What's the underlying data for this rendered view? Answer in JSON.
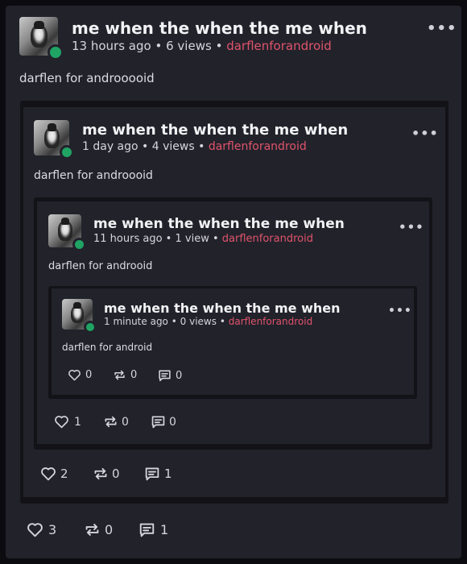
{
  "posts": [
    {
      "title": "me when the when the me when",
      "time": "13 hours ago",
      "views": "6 views",
      "username": "darflenforandroid",
      "body": "darflen for androoooid",
      "likes": "3",
      "reposts": "0",
      "comments": "1"
    },
    {
      "title": "me when the when the me when",
      "time": "1 day ago",
      "views": "4 views",
      "username": "darflenforandroid",
      "body": "darflen for androooid",
      "likes": "2",
      "reposts": "0",
      "comments": "1"
    },
    {
      "title": "me when the when the me when",
      "time": "11 hours ago",
      "views": "1 view",
      "username": "darflenforandroid",
      "body": "darflen for androoid",
      "likes": "1",
      "reposts": "0",
      "comments": "0"
    },
    {
      "title": "me when the when the me when",
      "time": "1 minute ago",
      "views": "0 views",
      "username": "darflenforandroid",
      "body": "darflen for android",
      "likes": "0",
      "reposts": "0",
      "comments": "0"
    }
  ],
  "separator": "•",
  "more_icon": "more-horizontal-icon",
  "colors": {
    "accent": "#e0546b",
    "online": "#1fa463",
    "card": "#22222b",
    "background": "#0b0b10"
  }
}
